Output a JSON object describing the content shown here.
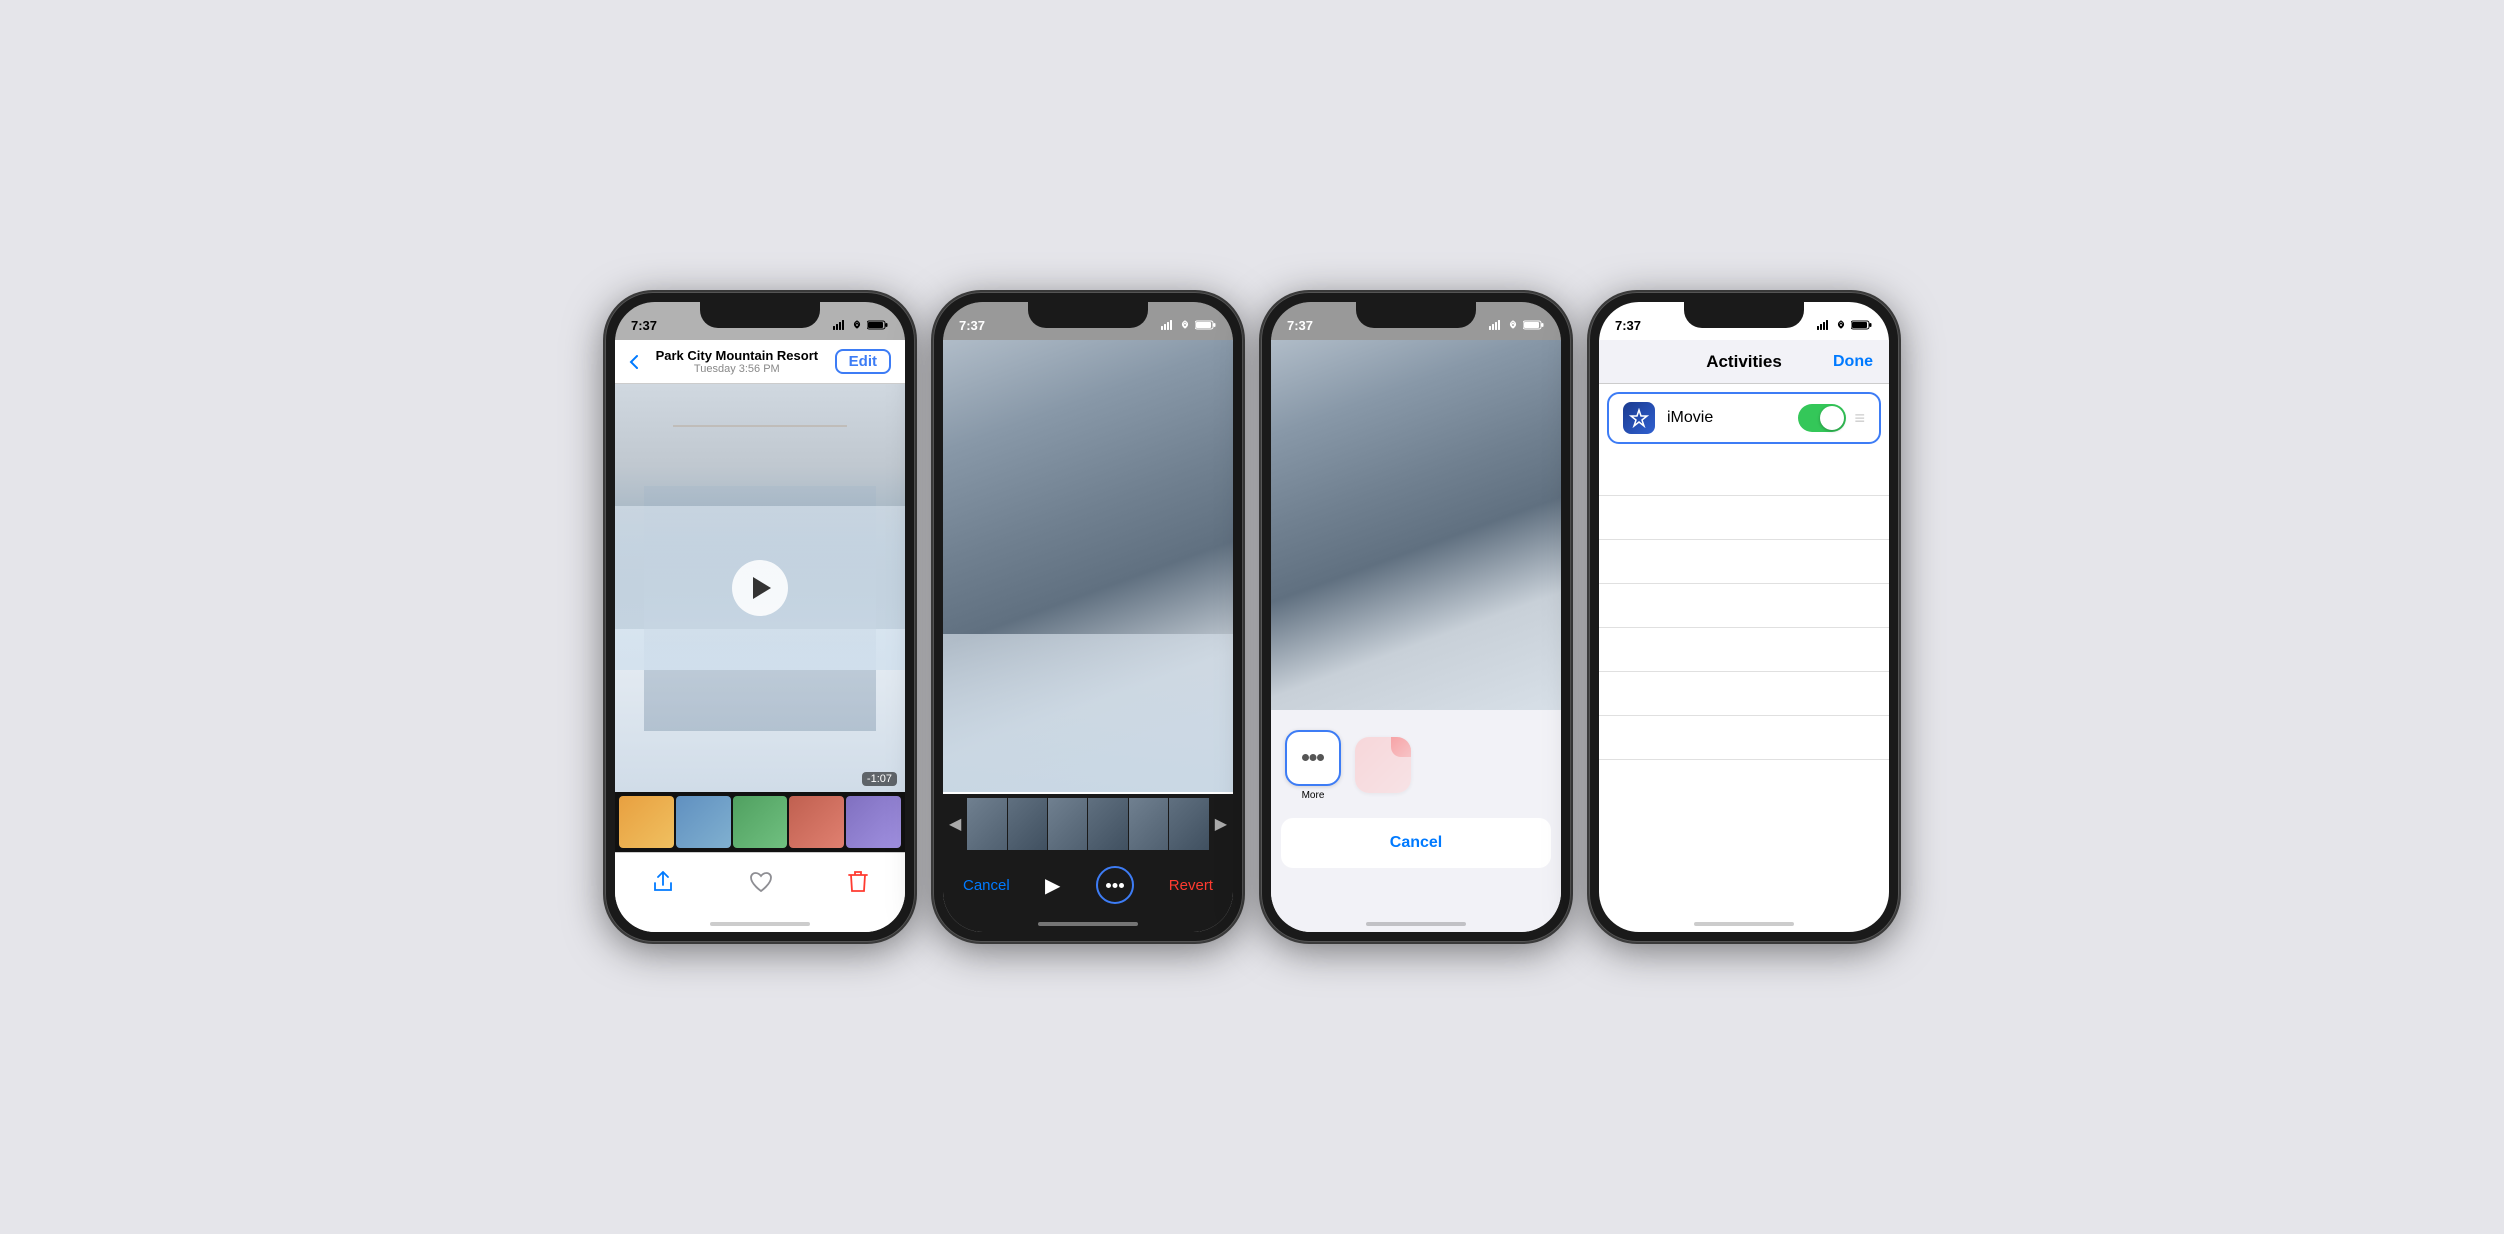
{
  "phone1": {
    "status_time": "7:37",
    "title": "Park City Mountain Resort",
    "subtitle": "Tuesday  3:56 PM",
    "edit_label": "Edit",
    "back_label": "",
    "duration": "-1:07",
    "bottom_bar": {
      "share": "share",
      "heart": "heart",
      "trash": "trash"
    }
  },
  "phone2": {
    "status_time": "7:37",
    "cancel_label": "Cancel",
    "revert_label": "Revert"
  },
  "phone3": {
    "status_time": "7:37",
    "more_label": "More",
    "cancel_label": "Cancel"
  },
  "phone4": {
    "status_time": "7:37",
    "title": "Activities",
    "done_label": "Done",
    "imovie_label": "iMovie"
  },
  "highlights": {
    "edit_ring_color": "#3d7cf5",
    "more_ring_color": "#3d7cf5",
    "dots_ring_color": "#3d7cf5",
    "imovie_ring_color": "#3d7cf5"
  }
}
